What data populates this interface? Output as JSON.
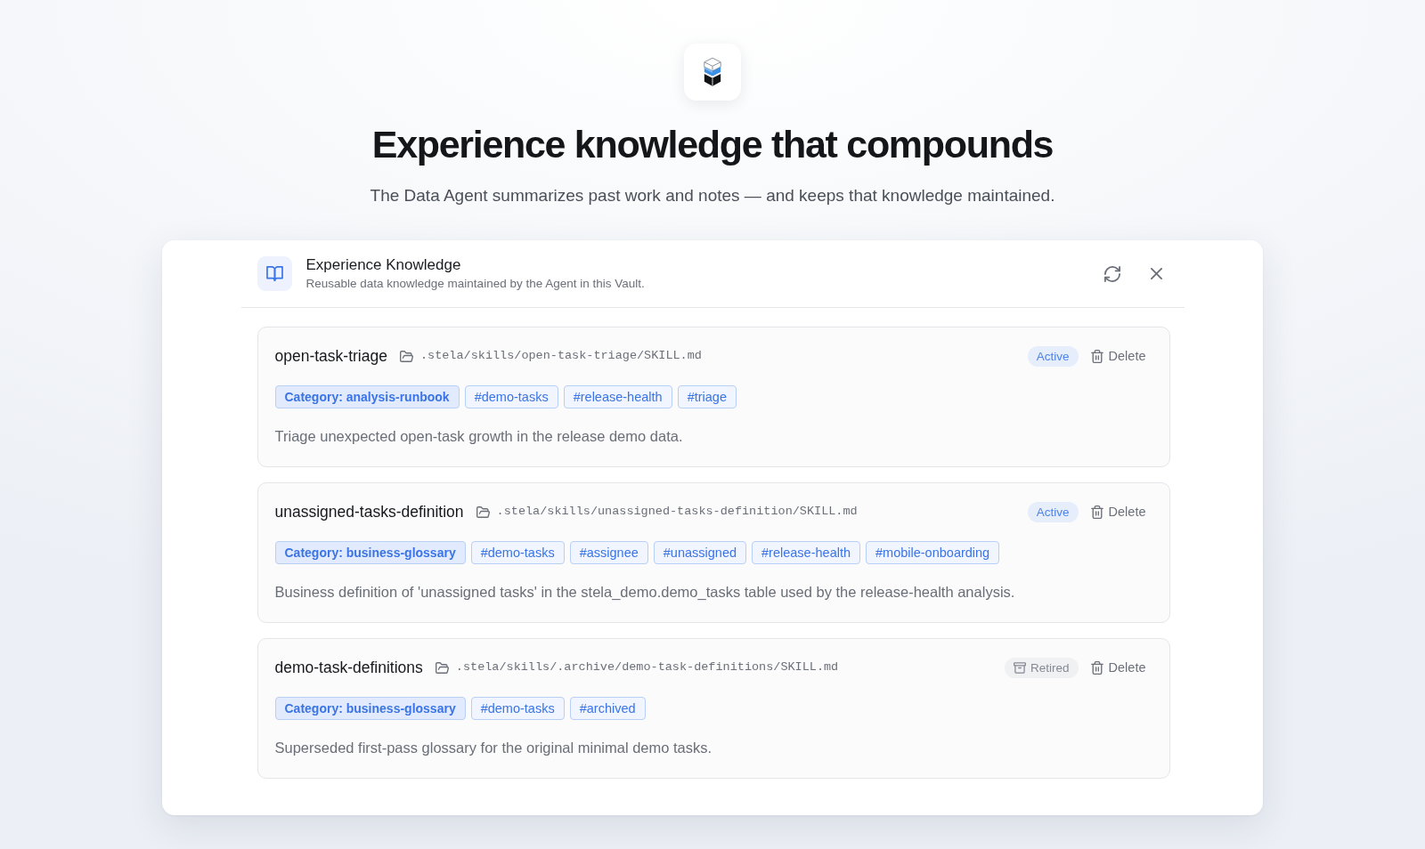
{
  "hero": {
    "title": "Experience knowledge that compounds",
    "subtitle": "The Data Agent summarizes past work and notes — and keeps that knowledge maintained."
  },
  "panel": {
    "title": "Experience Knowledge",
    "subtitle": "Reusable data knowledge maintained by the Agent in this Vault."
  },
  "skills": [
    {
      "name": "open-task-triage",
      "path": ".stela/skills/open-task-triage/SKILL.md",
      "status": {
        "kind": "active",
        "label": "Active"
      },
      "delete": "Delete",
      "tags": [
        {
          "kind": "category",
          "label": "Category: analysis-runbook"
        },
        {
          "kind": "tag",
          "label": "#demo-tasks"
        },
        {
          "kind": "tag",
          "label": "#release-health"
        },
        {
          "kind": "tag",
          "label": "#triage"
        }
      ],
      "description": "Triage unexpected open-task growth in the release demo data."
    },
    {
      "name": "unassigned-tasks-definition",
      "path": ".stela/skills/unassigned-tasks-definition/SKILL.md",
      "status": {
        "kind": "active",
        "label": "Active"
      },
      "delete": "Delete",
      "tags": [
        {
          "kind": "category",
          "label": "Category: business-glossary"
        },
        {
          "kind": "tag",
          "label": "#demo-tasks"
        },
        {
          "kind": "tag",
          "label": "#assignee"
        },
        {
          "kind": "tag",
          "label": "#unassigned"
        },
        {
          "kind": "tag",
          "label": "#release-health"
        },
        {
          "kind": "tag",
          "label": "#mobile-onboarding"
        }
      ],
      "description": "Business definition of 'unassigned tasks' in the stela_demo.demo_tasks table used by the release-health analysis."
    },
    {
      "name": "demo-task-definitions",
      "path": ".stela/skills/.archive/demo-task-definitions/SKILL.md",
      "status": {
        "kind": "retired",
        "label": "Retired"
      },
      "delete": "Delete",
      "tags": [
        {
          "kind": "category",
          "label": "Category: business-glossary"
        },
        {
          "kind": "tag",
          "label": "#demo-tasks"
        },
        {
          "kind": "tag",
          "label": "#archived"
        }
      ],
      "description": "Superseded first-pass glossary for the original minimal demo tasks."
    }
  ]
}
